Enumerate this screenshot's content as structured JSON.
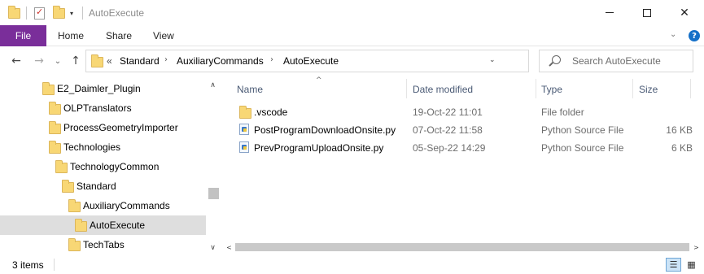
{
  "window": {
    "title": "AutoExecute",
    "quick_access": {
      "dropdown_glyph": "▾"
    },
    "controls": {
      "minimize_icon": "minimize-icon",
      "maximize_icon": "maximize-icon",
      "close_glyph": "✕"
    }
  },
  "ribbon": {
    "tabs": [
      {
        "label": "File",
        "active": true
      },
      {
        "label": "Home"
      },
      {
        "label": "Share"
      },
      {
        "label": "View"
      }
    ],
    "expand_glyph": "⌄",
    "help_glyph": "?"
  },
  "nav": {
    "back_glyph": "←",
    "forward_glyph": "→",
    "recent_glyph": "⌄",
    "up_glyph": "↑"
  },
  "address": {
    "overflow_glyph": "«",
    "separator_glyph": "›",
    "crumbs": [
      "Standard",
      "AuxiliaryCommands",
      "AutoExecute"
    ],
    "dropdown_glyph": "⌄",
    "refresh_glyph": "↻"
  },
  "search": {
    "placeholder": "Search AutoExecute"
  },
  "tree": {
    "items": [
      {
        "label": "E2_Daimler_Plugin"
      },
      {
        "label": "OLPTranslators"
      },
      {
        "label": "ProcessGeometryImporter"
      },
      {
        "label": "Technologies"
      },
      {
        "label": "TechnologyCommon"
      },
      {
        "label": "Standard"
      },
      {
        "label": "AuxiliaryCommands"
      },
      {
        "label": "AutoExecute",
        "selected": true
      },
      {
        "label": "TechTabs"
      }
    ],
    "scroll_up_glyph": "∧",
    "scroll_down_glyph": "∨"
  },
  "filelist": {
    "sort_glyph": "^",
    "columns": {
      "name": "Name",
      "date": "Date modified",
      "type": "Type",
      "size": "Size"
    },
    "rows": [
      {
        "name": ".vscode",
        "date": "19-Oct-22 11:01",
        "type": "File folder",
        "size": "",
        "icon": "folder-icon"
      },
      {
        "name": "PostProgramDownloadOnsite.py",
        "date": "07-Oct-22 11:58",
        "type": "Python Source File",
        "size": "16 KB",
        "icon": "python-file-icon"
      },
      {
        "name": "PrevProgramUploadOnsite.py",
        "date": "05-Sep-22 14:29",
        "type": "Python Source File",
        "size": "6 KB",
        "icon": "python-file-icon"
      }
    ],
    "hscroll_left_glyph": "<",
    "hscroll_right_glyph": ">"
  },
  "status": {
    "item_count": "3 items",
    "details_view_glyph": "☰",
    "tiles_view_glyph": "▦"
  },
  "colors": {
    "file_tab": "#7a2e9a",
    "folder": "#f8d775",
    "selection": "#dedede",
    "header_text": "#4a5a75"
  }
}
